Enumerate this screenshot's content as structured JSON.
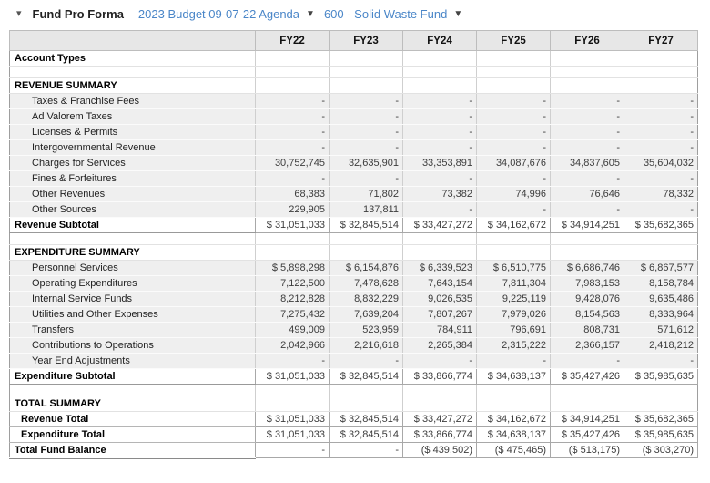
{
  "toolbar": {
    "collapse_caret": "▾",
    "title": "Fund Pro Forma",
    "dropdowns": [
      {
        "label": "2023 Budget 09-07-22 Agenda",
        "caret": "▼"
      },
      {
        "label": "600 - Solid Waste Fund",
        "caret": "▼"
      }
    ],
    "link_color": "#4a86c8"
  },
  "table": {
    "columns": [
      "FY22",
      "FY23",
      "FY24",
      "FY25",
      "FY26",
      "FY27"
    ],
    "rows": [
      {
        "type": "section",
        "label": "Account Types",
        "values": [
          "",
          "",
          "",
          "",
          "",
          ""
        ]
      },
      {
        "type": "blank",
        "label": "",
        "values": [
          "",
          "",
          "",
          "",
          "",
          ""
        ]
      },
      {
        "type": "section",
        "label": "REVENUE SUMMARY",
        "values": [
          "",
          "",
          "",
          "",
          "",
          ""
        ]
      },
      {
        "type": "data",
        "label": "Taxes & Franchise Fees",
        "values": [
          "-",
          "-",
          "-",
          "-",
          "-",
          "-"
        ]
      },
      {
        "type": "data",
        "label": "Ad Valorem Taxes",
        "values": [
          "-",
          "-",
          "-",
          "-",
          "-",
          "-"
        ]
      },
      {
        "type": "data",
        "label": "Licenses & Permits",
        "values": [
          "-",
          "-",
          "-",
          "-",
          "-",
          "-"
        ]
      },
      {
        "type": "data",
        "label": "Intergovernmental Revenue",
        "values": [
          "-",
          "-",
          "-",
          "-",
          "-",
          "-"
        ]
      },
      {
        "type": "data",
        "label": "Charges for Services",
        "values": [
          "30,752,745",
          "32,635,901",
          "33,353,891",
          "34,087,676",
          "34,837,605",
          "35,604,032"
        ]
      },
      {
        "type": "data",
        "label": "Fines & Forfeitures",
        "values": [
          "-",
          "-",
          "-",
          "-",
          "-",
          "-"
        ]
      },
      {
        "type": "data",
        "label": "Other Revenues",
        "values": [
          "68,383",
          "71,802",
          "73,382",
          "74,996",
          "76,646",
          "78,332"
        ]
      },
      {
        "type": "data",
        "label": "Other Sources",
        "values": [
          "229,905",
          "137,811",
          "-",
          "-",
          "-",
          "-"
        ]
      },
      {
        "type": "subtotal",
        "label": "Revenue Subtotal",
        "values": [
          "$ 31,051,033",
          "$ 32,845,514",
          "$ 33,427,272",
          "$ 34,162,672",
          "$ 34,914,251",
          "$ 35,682,365"
        ]
      },
      {
        "type": "blank",
        "label": "",
        "values": [
          "",
          "",
          "",
          "",
          "",
          ""
        ]
      },
      {
        "type": "section",
        "label": "EXPENDITURE SUMMARY",
        "values": [
          "",
          "",
          "",
          "",
          "",
          ""
        ]
      },
      {
        "type": "data",
        "label": "Personnel Services",
        "values": [
          "$ 5,898,298",
          "$ 6,154,876",
          "$ 6,339,523",
          "$ 6,510,775",
          "$ 6,686,746",
          "$ 6,867,577"
        ]
      },
      {
        "type": "data",
        "label": "Operating Expenditures",
        "values": [
          "7,122,500",
          "7,478,628",
          "7,643,154",
          "7,811,304",
          "7,983,153",
          "8,158,784"
        ]
      },
      {
        "type": "data",
        "label": "Internal Service Funds",
        "values": [
          "8,212,828",
          "8,832,229",
          "9,026,535",
          "9,225,119",
          "9,428,076",
          "9,635,486"
        ]
      },
      {
        "type": "data",
        "label": "Utilities and Other Expenses",
        "values": [
          "7,275,432",
          "7,639,204",
          "7,807,267",
          "7,979,026",
          "8,154,563",
          "8,333,964"
        ]
      },
      {
        "type": "data",
        "label": "Transfers",
        "values": [
          "499,009",
          "523,959",
          "784,911",
          "796,691",
          "808,731",
          "571,612"
        ]
      },
      {
        "type": "data",
        "label": "Contributions to Operations",
        "values": [
          "2,042,966",
          "2,216,618",
          "2,265,384",
          "2,315,222",
          "2,366,157",
          "2,418,212"
        ]
      },
      {
        "type": "data",
        "label": "Year End Adjustments",
        "values": [
          "-",
          "-",
          "-",
          "-",
          "-",
          "-"
        ]
      },
      {
        "type": "subtotal",
        "label": "Expenditure Subtotal",
        "values": [
          "$ 31,051,033",
          "$ 32,845,514",
          "$ 33,866,774",
          "$ 34,638,137",
          "$ 35,427,426",
          "$ 35,985,635"
        ]
      },
      {
        "type": "blank",
        "label": "",
        "values": [
          "",
          "",
          "",
          "",
          "",
          ""
        ]
      },
      {
        "type": "section",
        "label": "TOTAL SUMMARY",
        "values": [
          "",
          "",
          "",
          "",
          "",
          ""
        ]
      },
      {
        "type": "total",
        "label": "Revenue Total",
        "values": [
          "$ 31,051,033",
          "$ 32,845,514",
          "$ 33,427,272",
          "$ 34,162,672",
          "$ 34,914,251",
          "$ 35,682,365"
        ]
      },
      {
        "type": "total",
        "label": "Expenditure Total",
        "values": [
          "$ 31,051,033",
          "$ 32,845,514",
          "$ 33,866,774",
          "$ 34,638,137",
          "$ 35,427,426",
          "$ 35,985,635"
        ]
      },
      {
        "type": "balance",
        "label": "Total Fund Balance",
        "values": [
          "-",
          "-",
          "($ 439,502)",
          "($ 475,465)",
          "($ 513,175)",
          "($ 303,270)"
        ]
      }
    ]
  }
}
